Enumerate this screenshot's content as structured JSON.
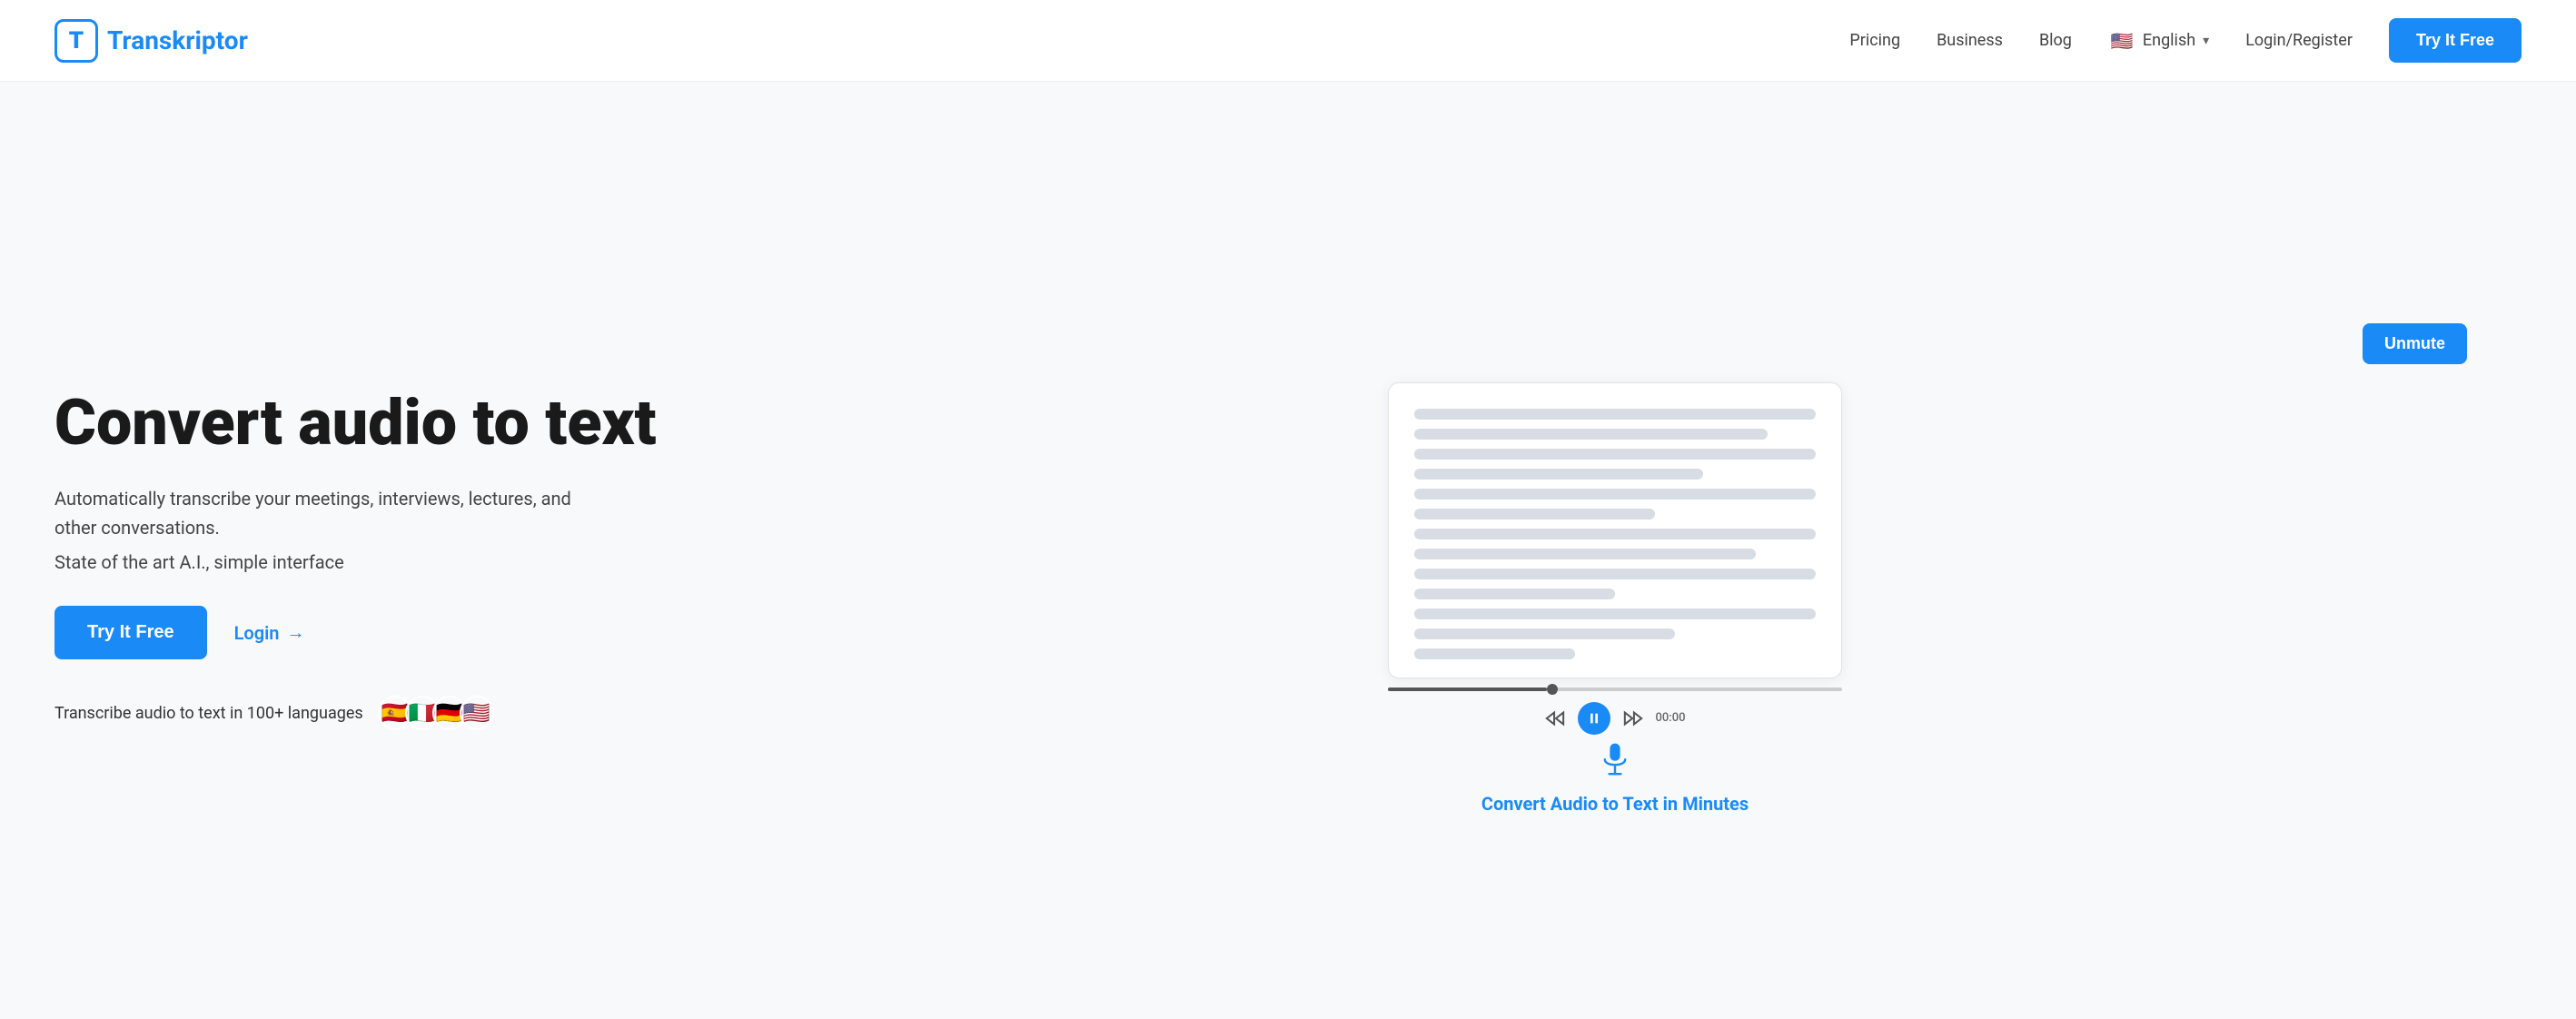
{
  "navbar": {
    "logo_letter": "T",
    "logo_brand": "ranskriptor",
    "nav_items": [
      {
        "label": "Pricing",
        "id": "pricing"
      },
      {
        "label": "Business",
        "id": "business"
      },
      {
        "label": "Blog",
        "id": "blog"
      }
    ],
    "language": {
      "flag_emoji": "🇺🇸",
      "label": "English",
      "chevron": "▾"
    },
    "login_label": "Login/Register",
    "try_free_label": "Try It Free"
  },
  "hero": {
    "title": "Convert audio to text",
    "subtitle": "Automatically transcribe your meetings, interviews, lectures, and other conversations.",
    "feature": "State of the art A.I., simple interface",
    "try_free_label": "Try It Free",
    "login_label": "Login",
    "login_arrow": "→",
    "languages_text": "Transcribe audio to text in 100+ languages",
    "flags": [
      "🇪🇸",
      "🇮🇹",
      "🇩🇪",
      "🇺🇸"
    ]
  },
  "demo": {
    "unmute_label": "Unmute",
    "progress_pct": 35,
    "time_display": "00:00",
    "caption": "Convert Audio to Text in Minutes",
    "lines": [
      {
        "width": "100%"
      },
      {
        "width": "88%"
      },
      {
        "width": "100%"
      },
      {
        "width": "72%"
      },
      {
        "width": "100%"
      },
      {
        "width": "60%"
      },
      {
        "width": "100%"
      },
      {
        "width": "85%"
      },
      {
        "width": "100%"
      },
      {
        "width": "50%"
      },
      {
        "width": "100%"
      },
      {
        "width": "65%"
      },
      {
        "width": "40%"
      }
    ]
  }
}
